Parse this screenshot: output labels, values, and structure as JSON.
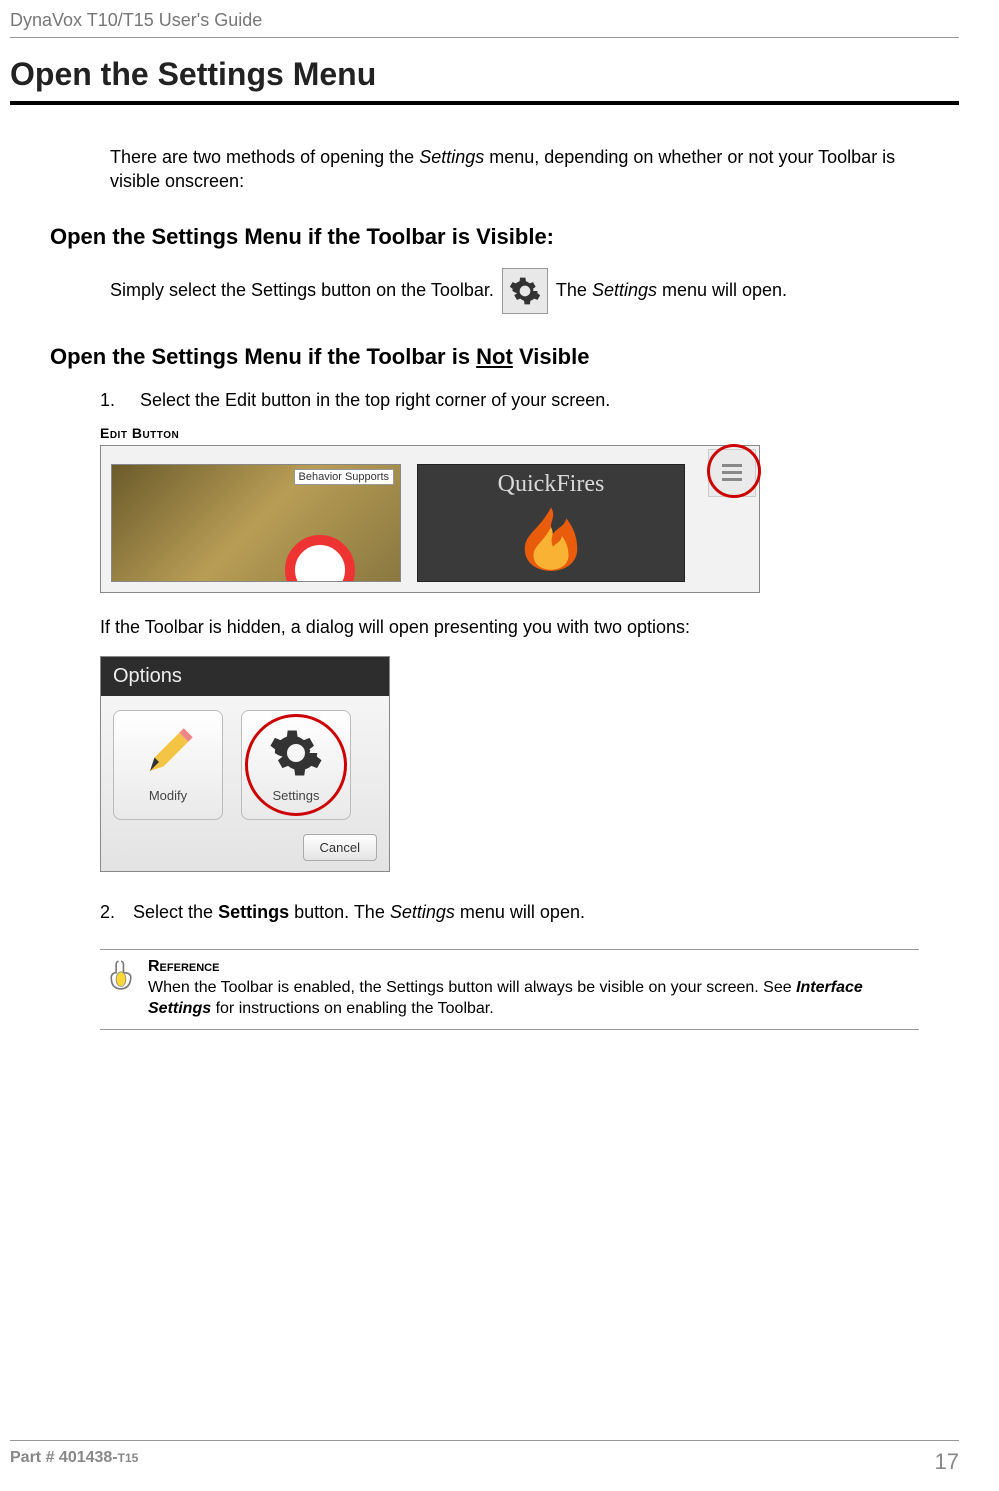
{
  "header": {
    "running": "DynaVox T10/T15 User's Guide"
  },
  "title": "Open the Settings Menu",
  "intro": {
    "pre": "There are two methods of opening the ",
    "em": "Settings",
    "post": " menu, depending on whether or not your Toolbar is visible onscreen:"
  },
  "section1": {
    "heading": "Open the Settings Menu if the Toolbar is Visible:",
    "line_pre": "Simply select the Settings button on the Toolbar.",
    "line_post_pre": " The ",
    "line_post_em": "Settings",
    "line_post_post": " menu will open."
  },
  "section2": {
    "heading_pre": "Open the Settings Menu if the Toolbar is ",
    "heading_underline": "Not",
    "heading_post": " Visible",
    "step1": {
      "num": "1.",
      "text": "Select the Edit button in the top right corner of your screen."
    },
    "caption": "Edit Button",
    "shot1": {
      "badge": "Behavior Supports",
      "quickfires": "QuickFires"
    },
    "after_shot": "If the Toolbar is hidden, a dialog will open presenting you with two options:",
    "shot2": {
      "title": "Options",
      "modify": "Modify",
      "settings": "Settings",
      "cancel": "Cancel"
    },
    "step2": {
      "num": "2.",
      "pre": "Select the ",
      "b": "Settings",
      "mid": " button. The ",
      "em": "Settings",
      "post": " menu will open."
    }
  },
  "reference": {
    "title": "Reference",
    "pre": "When the Toolbar is enabled, the Settings button will always be visible on your screen. See ",
    "bold": "Interface Settings",
    "post": " for instructions on enabling the Toolbar."
  },
  "footer": {
    "part_pre": "Part # 401438-",
    "part_suffix": "T15",
    "page": "17"
  }
}
